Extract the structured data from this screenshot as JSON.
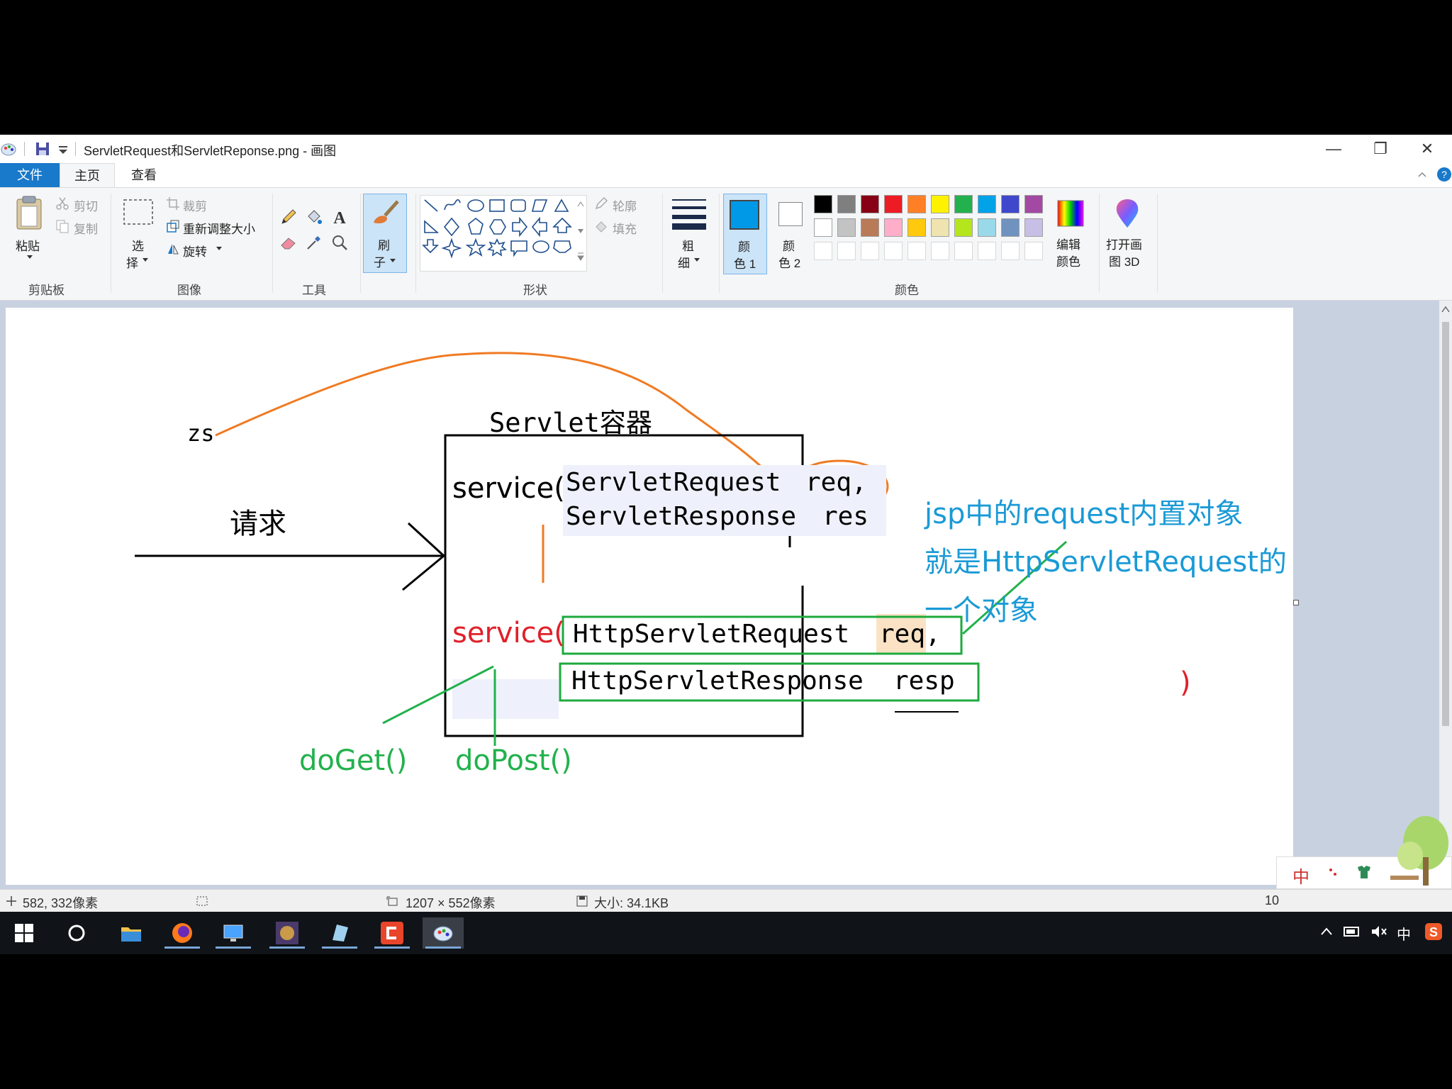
{
  "window": {
    "title": "ServletRequest和ServletReponse.png - 画图",
    "minimize": "—",
    "restore": "❐",
    "close": "✕"
  },
  "menu": {
    "file": "文件",
    "home": "主页",
    "view": "查看"
  },
  "ribbon": {
    "clipboard": {
      "paste": "粘贴",
      "cut": "剪切",
      "copy": "复制",
      "label": "剪贴板"
    },
    "image": {
      "select_1": "选",
      "select_2": "择",
      "crop": "裁剪",
      "resize": "重新调整大小",
      "rotate": "旋转",
      "label": "图像"
    },
    "tools": {
      "label": "工具"
    },
    "brush": {
      "line1": "刷",
      "line2": "子"
    },
    "shapes": {
      "outline": "轮廓",
      "fill": "填充",
      "label": "形状"
    },
    "size": {
      "line1": "粗",
      "line2": "细"
    },
    "color1": {
      "line1": "颜",
      "line2": "色 1"
    },
    "color2": {
      "line1": "颜",
      "line2": "色 2"
    },
    "palette_label": "颜色",
    "edit_colors": {
      "line1": "编辑",
      "line2": "颜色"
    },
    "paint3d": {
      "line1": "打开画",
      "line2": "图 3D"
    },
    "palette": [
      "#000000",
      "#7f7f7f",
      "#880015",
      "#ed1c24",
      "#ff7f27",
      "#fff200",
      "#22b14c",
      "#00a2e8",
      "#3f48cc",
      "#a349a4",
      "#ffffff",
      "#c3c3c3",
      "#b97a57",
      "#ffaec9",
      "#ffc90e",
      "#efe4b0",
      "#b5e61d",
      "#99d9ea",
      "#7092be",
      "#c8bfe7"
    ],
    "color1_value": "#0099e8",
    "color2_value": "#ffffff"
  },
  "drawing": {
    "zs": "zs",
    "request_label": "请求",
    "container_title": "Servlet容器",
    "service_1": "service(",
    "servlet_request": "ServletRequest",
    "req_1": "req,",
    "servlet_response": "ServletResponse",
    "res": "res",
    "service_2": "service(",
    "http_request": "HttpServletRequest",
    "req_2": "req,",
    "http_response": "HttpServletResponse",
    "resp": "resp",
    "close_paren": ")",
    "note_line1": "jsp中的request内置对象",
    "note_line2": "就是HttpServletRequest的",
    "note_line3": "一个对象",
    "do_get": "doGet()",
    "do_post": "doPost()"
  },
  "status": {
    "cursor": "582, 332像素",
    "dimensions": "1207 × 552像素",
    "size": "大小: 34.1KB",
    "zoom": "10"
  },
  "taskbar": {
    "ime": "中"
  },
  "colors": {
    "orange": "#f07a22",
    "green": "#22b14c",
    "blue_text": "#1a9ad6",
    "red_text": "#e0202a",
    "greenbox": "#1daa3c"
  }
}
